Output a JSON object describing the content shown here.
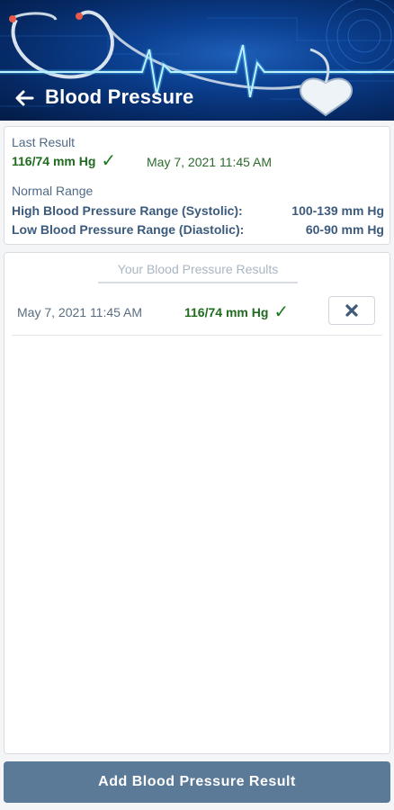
{
  "header": {
    "title": "Blood Pressure",
    "back_icon": "arrow-left-icon"
  },
  "summary": {
    "last_result_label": "Last Result",
    "last_result_value": "116/74 mm Hg",
    "last_result_status_icon": "check-icon",
    "last_result_date": "May 7, 2021 11:45 AM",
    "normal_range_label": "Normal Range",
    "ranges": [
      {
        "label": "High Blood Pressure Range (Systolic):",
        "value": "100-139 mm Hg"
      },
      {
        "label": "Low Blood Pressure Range (Diastolic):",
        "value": "60-90 mm Hg"
      }
    ]
  },
  "results": {
    "heading": "Your Blood Pressure Results",
    "rows": [
      {
        "date": "May 7, 2021 11:45 AM",
        "value": "116/74 mm Hg",
        "status_icon": "check-icon",
        "delete_icon": "close-x-icon"
      }
    ]
  },
  "footer": {
    "add_label": "Add Blood Pressure Result"
  },
  "colors": {
    "header_bg": "#062a66",
    "good_value": "#1f6b1f",
    "label": "#4f6a86",
    "button_bg": "#5b7a98"
  }
}
